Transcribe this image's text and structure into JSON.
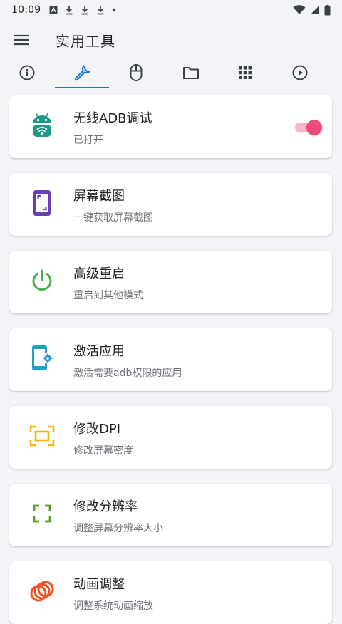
{
  "status_bar": {
    "time": "10:09",
    "icons": [
      "a-icon",
      "download-icon",
      "download-icon",
      "download-icon",
      "dot-icon"
    ],
    "right_icons": [
      "wifi-icon",
      "signal-icon",
      "battery-icon"
    ]
  },
  "app_bar": {
    "title": "实用工具",
    "menu_icon": "menu-icon"
  },
  "tabs": [
    {
      "name": "info",
      "icon": "info-icon",
      "active": false
    },
    {
      "name": "tools",
      "icon": "wrench-icon",
      "active": true
    },
    {
      "name": "mouse",
      "icon": "mouse-icon",
      "active": false
    },
    {
      "name": "folder",
      "icon": "folder-icon",
      "active": false
    },
    {
      "name": "apps",
      "icon": "grid-icon",
      "active": false
    },
    {
      "name": "play",
      "icon": "play-icon",
      "active": false
    }
  ],
  "items": [
    {
      "title": "无线ADB调试",
      "subtitle": "已打开",
      "icon": "android-wifi-icon",
      "color": "#1a9a8a",
      "toggle": true
    },
    {
      "title": "屏幕截图",
      "subtitle": "一键获取屏幕截图",
      "icon": "screenshot-icon",
      "color": "#6a3fb5"
    },
    {
      "title": "高级重启",
      "subtitle": "重启到其他模式",
      "icon": "power-icon",
      "color": "#4caf50"
    },
    {
      "title": "激活应用",
      "subtitle": "激活需要adb权限的应用",
      "icon": "phone-settings-icon",
      "color": "#1ba3c4"
    },
    {
      "title": "修改DPI",
      "subtitle": "修改屏幕密度",
      "icon": "dpi-icon",
      "color": "#f4b400"
    },
    {
      "title": "修改分辨率",
      "subtitle": "调整屏幕分辨率大小",
      "icon": "fullscreen-icon",
      "color": "#5a9a2e"
    },
    {
      "title": "动画调整",
      "subtitle": "调整系统动画缩放",
      "icon": "rings-icon",
      "color": "#f4511e"
    }
  ],
  "toggle_colors": {
    "track": "#f6b6c8",
    "thumb": "#ec4c7c"
  },
  "accent": "#1976d2"
}
